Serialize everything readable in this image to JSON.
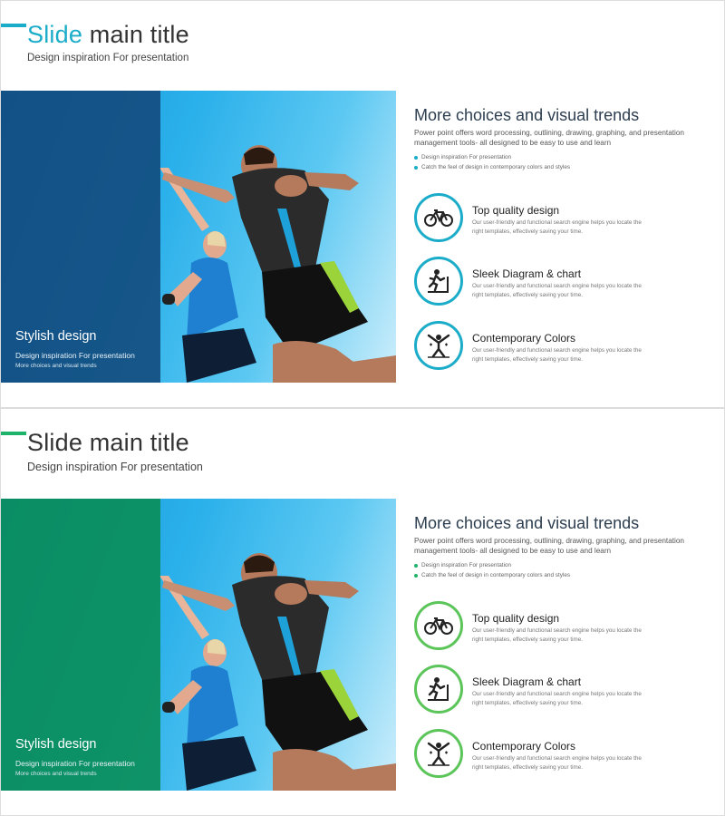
{
  "slides": [
    {
      "title_highlight": "Slide",
      "title_rest": " main title",
      "subtitle": "Design inspiration For presentation",
      "accent_color": "#1aacc9",
      "overlay_color": "#124678",
      "overlay": {
        "title": "Stylish design",
        "sub": "Design inspiration For presentation",
        "sub2": "More choices and visual trends"
      },
      "heading": "More choices and visual trends",
      "description": "Power point offers word processing, outlining, drawing, graphing, and presentation management tools- all designed to be easy to use and learn",
      "bullets": [
        "Design inspiration For presentation",
        "Catch the feel of design in contemporary colors and styles"
      ],
      "features": [
        {
          "icon": "bicycle-icon",
          "title": "Top quality design",
          "desc": "Our user-friendly and functional search engine helps you locate the right templates, effectively saving your time."
        },
        {
          "icon": "treadmill-icon",
          "title": "Sleek Diagram & chart",
          "desc": "Our user-friendly and functional search engine helps you locate the right templates, effectively saving your time."
        },
        {
          "icon": "gymnastics-icon",
          "title": "Contemporary Colors",
          "desc": "Our user-friendly and functional search engine helps you locate the right templates, effectively saving your time."
        }
      ]
    },
    {
      "title_highlight": "",
      "title_rest": "Slide main title",
      "subtitle": "Design inspiration For presentation",
      "accent_color": "#1db36b",
      "overlay_color": "#088c50",
      "overlay": {
        "title": "Stylish design",
        "sub": "Design inspiration For presentation",
        "sub2": "More choices and visual trends"
      },
      "heading": "More choices and visual trends",
      "description": "Power point offers word processing, outlining, drawing, graphing, and presentation management tools- all designed to be easy to use and learn",
      "bullets": [
        "Design inspiration For presentation",
        "Catch the feel of design in contemporary colors and styles"
      ],
      "features": [
        {
          "icon": "bicycle-icon",
          "title": "Top quality design",
          "desc": "Our user-friendly and functional search engine helps you locate the right templates, effectively saving your time."
        },
        {
          "icon": "treadmill-icon",
          "title": "Sleek Diagram & chart",
          "desc": "Our user-friendly and functional search engine helps you locate the right templates, effectively saving your time."
        },
        {
          "icon": "gymnastics-icon",
          "title": "Contemporary Colors",
          "desc": "Our user-friendly and functional search engine helps you locate the right templates, effectively saving your time."
        }
      ]
    }
  ]
}
